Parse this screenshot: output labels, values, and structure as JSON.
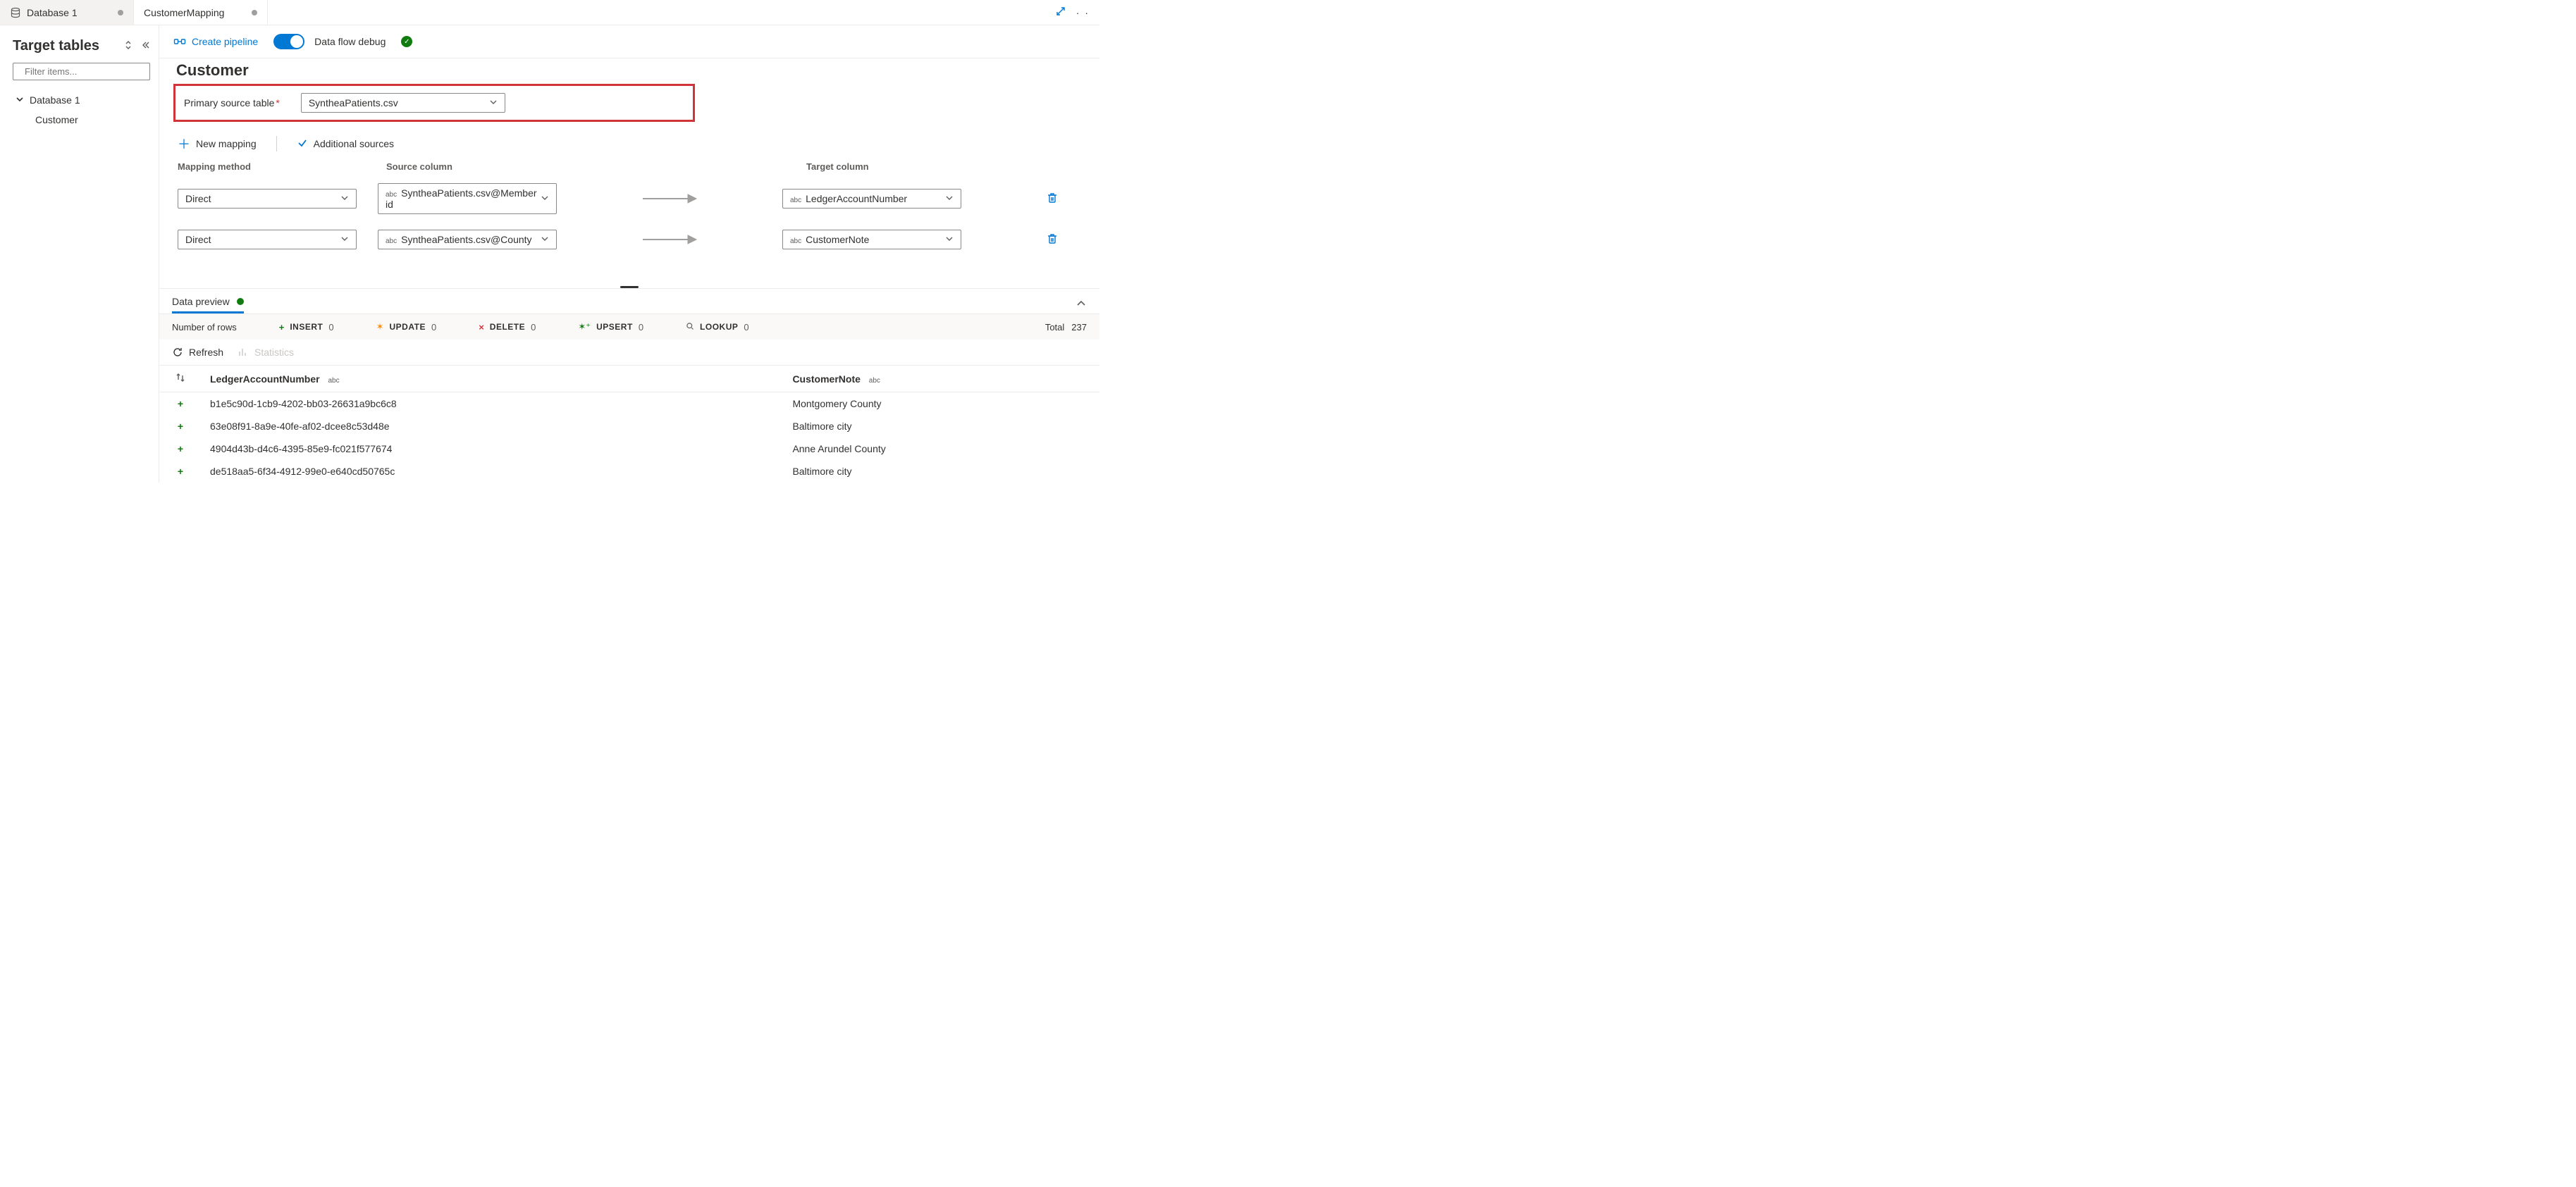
{
  "tabs": [
    {
      "label": "Database 1",
      "active": false
    },
    {
      "label": "CustomerMapping",
      "active": true
    }
  ],
  "sidebar": {
    "title": "Target tables",
    "filter_placeholder": "Filter items...",
    "tree": {
      "root_label": "Database 1",
      "children": [
        {
          "label": "Customer"
        }
      ]
    }
  },
  "toolbar": {
    "create_pipeline": "Create pipeline",
    "debug_label": "Data flow debug",
    "debug_enabled": true
  },
  "entity": {
    "name": "Customer",
    "primary_source_label": "Primary source table",
    "primary_source_value": "SyntheaPatients.csv"
  },
  "mapping_actions": {
    "new_mapping": "New mapping",
    "additional_sources": "Additional sources"
  },
  "mapping_headers": {
    "method": "Mapping method",
    "source": "Source column",
    "target": "Target column"
  },
  "mappings": [
    {
      "method": "Direct",
      "source": "SyntheaPatients.csv@Member id",
      "target": "LedgerAccountNumber"
    },
    {
      "method": "Direct",
      "source": "SyntheaPatients.csv@County",
      "target": "CustomerNote"
    }
  ],
  "data_preview": {
    "tab_label": "Data preview",
    "rows_label": "Number of rows",
    "counts": {
      "insert_k": "Insert",
      "insert_v": "0",
      "update_k": "Update",
      "update_v": "0",
      "delete_k": "Delete",
      "delete_v": "0",
      "upsert_k": "Upsert",
      "upsert_v": "0",
      "lookup_k": "Lookup",
      "lookup_v": "0",
      "total_k": "Total",
      "total_v": "237"
    },
    "refresh": "Refresh",
    "statistics": "Statistics",
    "columns": [
      {
        "name": "LedgerAccountNumber",
        "type": "abc"
      },
      {
        "name": "CustomerNote",
        "type": "abc"
      }
    ],
    "rows": [
      {
        "c0": "b1e5c90d-1cb9-4202-bb03-26631a9bc6c8",
        "c1": "Montgomery County"
      },
      {
        "c0": "63e08f91-8a9e-40fe-af02-dcee8c53d48e",
        "c1": "Baltimore city"
      },
      {
        "c0": "4904d43b-d4c6-4395-85e9-fc021f577674",
        "c1": "Anne Arundel County"
      },
      {
        "c0": "de518aa5-6f34-4912-99e0-e640cd50765c",
        "c1": "Baltimore city"
      }
    ]
  }
}
